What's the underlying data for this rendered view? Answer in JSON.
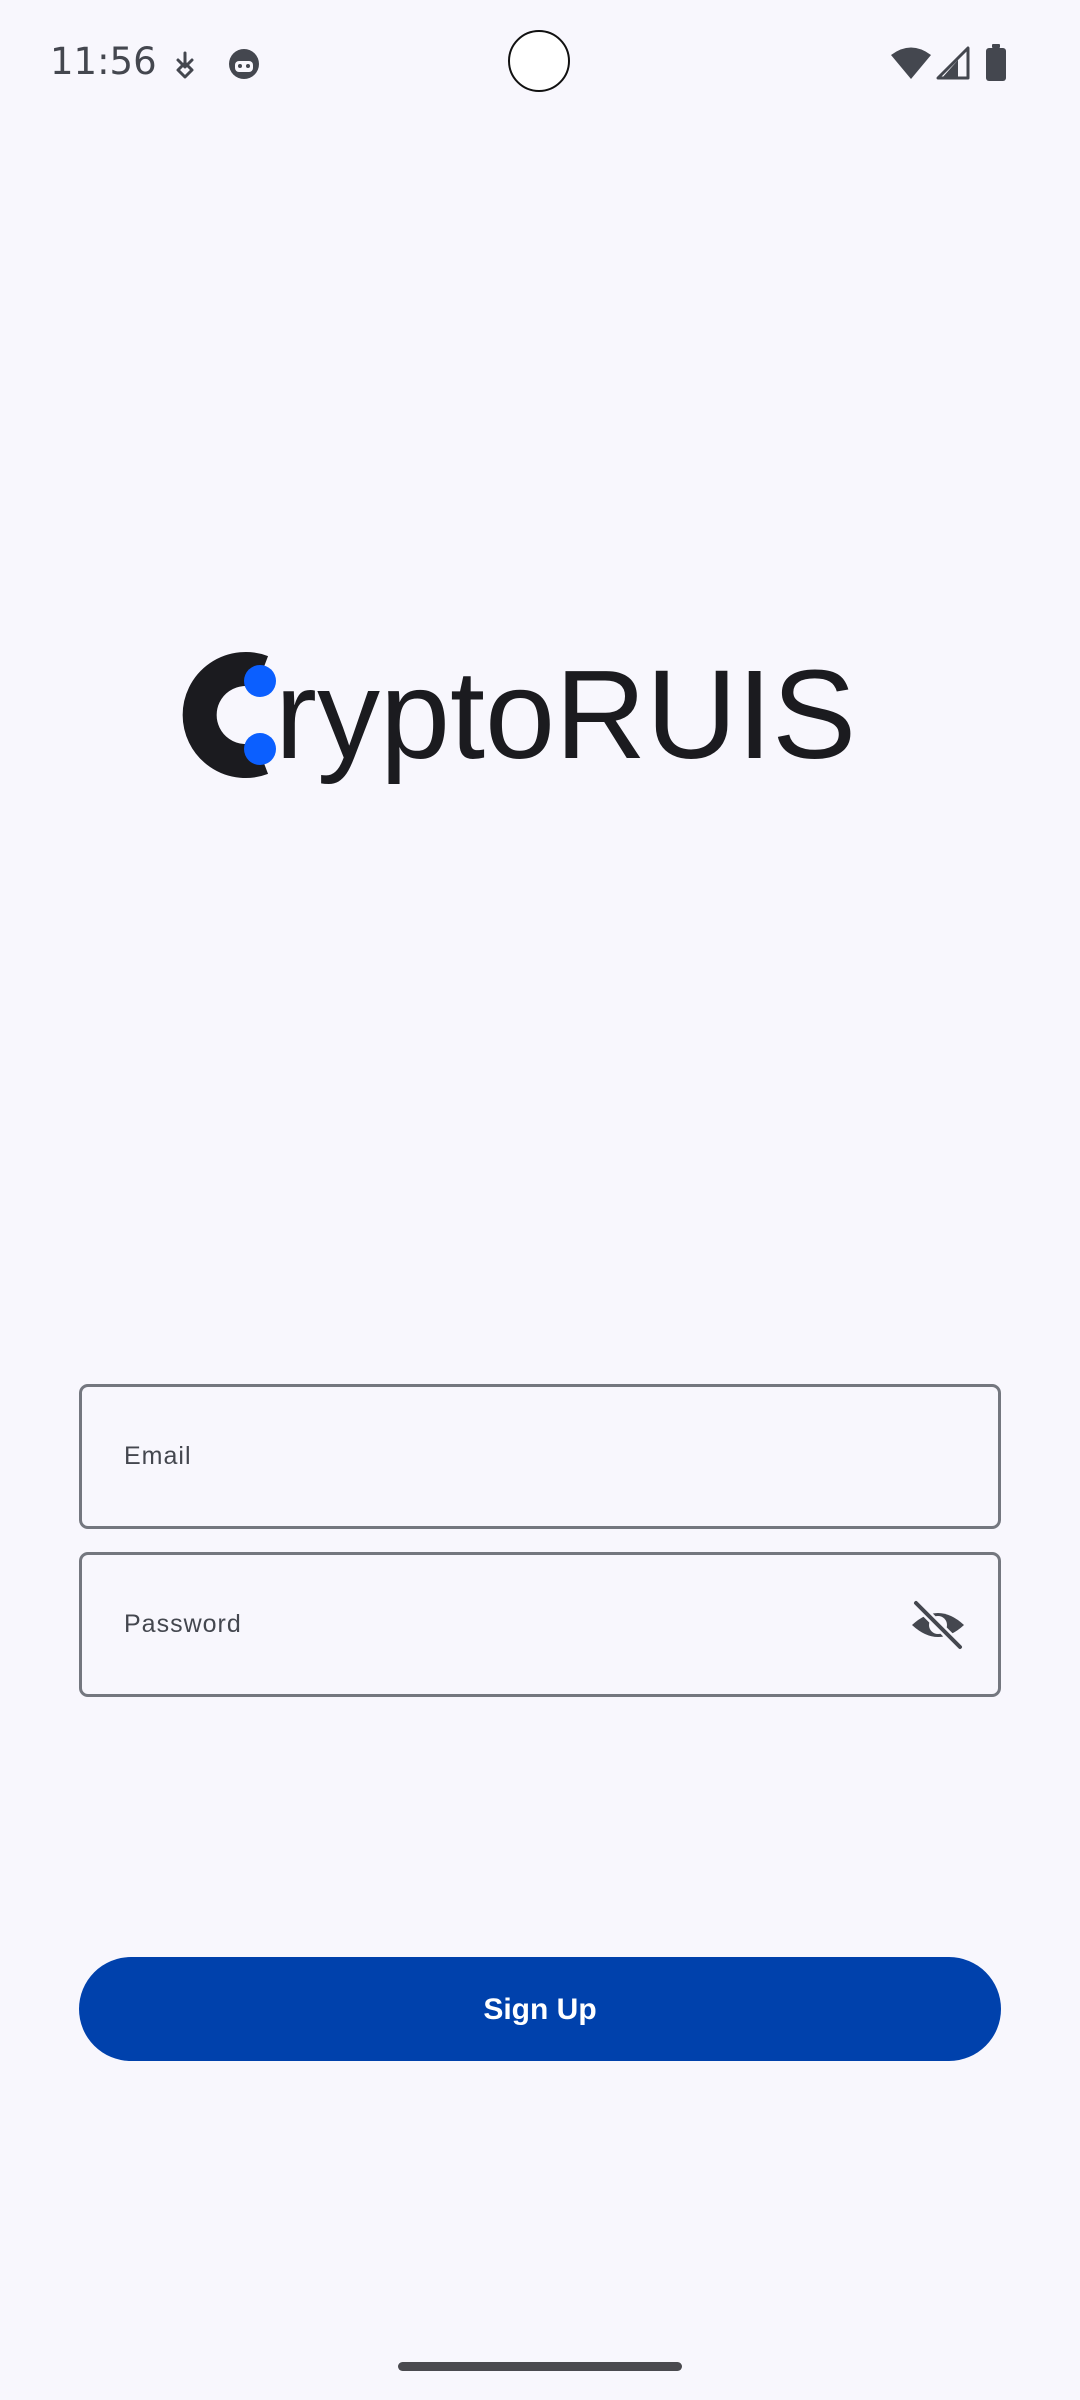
{
  "status_bar": {
    "time": "11:56",
    "icons": [
      "notification-arrow-icon",
      "android-face-icon",
      "wifi-icon",
      "cellular-signal-icon",
      "battery-icon"
    ]
  },
  "logo": {
    "text": "ryptoRUIS",
    "full_name": "CryptoRUIS",
    "colors": {
      "dark": "#1b1b1f",
      "accent": "#0b5fff"
    }
  },
  "form": {
    "email_label": "Email",
    "password_label": "Password",
    "password_toggle_icon": "eye-off-icon"
  },
  "actions": {
    "signup_label": "Sign Up"
  },
  "theme": {
    "background": "#f8f7fd",
    "primary": "#0041ac",
    "outline": "#74777f"
  }
}
